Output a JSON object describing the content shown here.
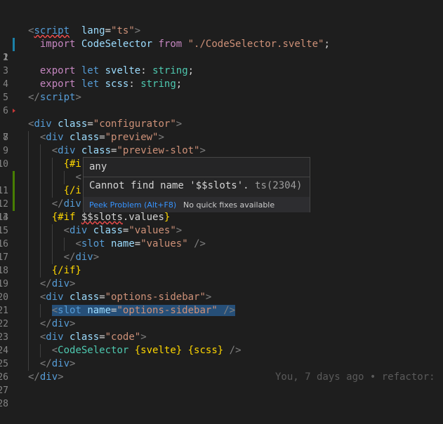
{
  "editor": {
    "lines": [
      {
        "n": "1",
        "active": true
      },
      {
        "n": "2"
      },
      {
        "n": "3"
      },
      {
        "n": "4"
      },
      {
        "n": "5"
      },
      {
        "n": "6"
      },
      {
        "n": "7"
      },
      {
        "n": "8"
      },
      {
        "n": "9"
      },
      {
        "n": "10"
      },
      {
        "n": "11"
      },
      {
        "n": "12"
      },
      {
        "n": "13"
      },
      {
        "n": "14"
      },
      {
        "n": "15"
      },
      {
        "n": "16"
      },
      {
        "n": "17"
      },
      {
        "n": "18"
      },
      {
        "n": "19"
      },
      {
        "n": "20"
      },
      {
        "n": "21"
      },
      {
        "n": "22"
      },
      {
        "n": "23"
      },
      {
        "n": "24"
      },
      {
        "n": "25"
      },
      {
        "n": "26"
      },
      {
        "n": "27"
      },
      {
        "n": "28"
      }
    ],
    "tokens": {
      "l1": [
        "<",
        "script",
        "lang",
        "=",
        "\"ts\"",
        ">"
      ],
      "l2": [
        "import",
        "CodeSelector",
        "from",
        "\"./CodeSelector.svelte\"",
        ";"
      ],
      "l4": [
        "export",
        "let",
        "svelte",
        ":",
        "string",
        ";"
      ],
      "l5": [
        "export",
        "let",
        "scss",
        ":",
        "string",
        ";"
      ],
      "l6": [
        "</",
        "script",
        ">"
      ],
      "l8": [
        "<",
        "div",
        "class",
        "=",
        "\"configurator\"",
        ">"
      ],
      "l9": [
        "<",
        "div",
        "class",
        "=",
        "\"preview\"",
        ">"
      ],
      "l10": [
        "<",
        "div",
        "class",
        "=",
        "\"preview-slot\"",
        ">"
      ],
      "l11": [
        "{#i"
      ],
      "l12": [
        "<"
      ],
      "l13": [
        "{/i"
      ],
      "l14": [
        "</",
        "div"
      ],
      "l15": [
        "{#if",
        "$$slots",
        ".values",
        "}"
      ],
      "l16": [
        "<",
        "div",
        "class",
        "=",
        "\"values\"",
        ">"
      ],
      "l17": [
        "<",
        "slot",
        "name",
        "=",
        "\"values\"",
        "/>"
      ],
      "l18": [
        "</",
        "div",
        ">"
      ],
      "l19": [
        "{/if}"
      ],
      "l20": [
        "</",
        "div",
        ">"
      ],
      "l21": [
        "<",
        "div",
        "class",
        "=",
        "\"options-sidebar\"",
        ">"
      ],
      "l22": [
        "<",
        "slot",
        "name",
        "=",
        "\"options-sidebar\"",
        "/>"
      ],
      "l23": [
        "</",
        "div",
        ">"
      ],
      "l24": [
        "<",
        "div",
        "class",
        "=",
        "\"code\"",
        ">"
      ],
      "l25": [
        "<",
        "CodeSelector",
        "{svelte}",
        "{scss}",
        "/>"
      ],
      "l26": [
        "</",
        "div",
        ">"
      ],
      "l27": [
        "</",
        "div",
        ">"
      ]
    },
    "blame": "You, 7 days ago • refactor:"
  },
  "hover": {
    "type_text": "any",
    "message": "Cannot find name '$$slots'.",
    "code": "ts(2304)",
    "peek_label": "Peek Problem (Alt+F8)",
    "no_fix_label": "No quick fixes available"
  },
  "colors": {
    "background": "#1e1e1e",
    "git_modified": "#1b81a8",
    "git_added": "#487e02",
    "error": "#f14c4c",
    "selection": "#264f78"
  }
}
